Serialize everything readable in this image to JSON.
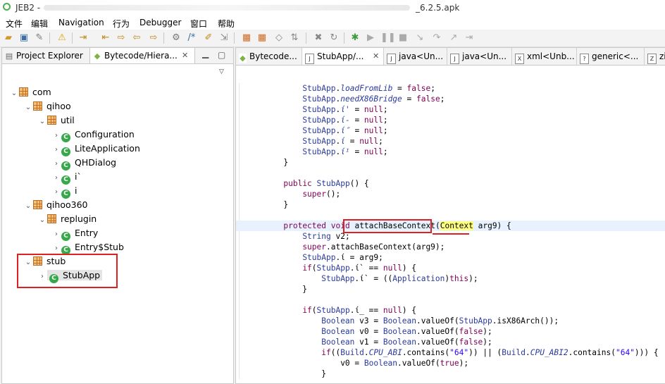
{
  "window": {
    "title_prefix": "JEB2 -",
    "title_suffix": "_6.2.5.apk"
  },
  "menu": [
    "文件",
    "编辑",
    "Navigation",
    "行为",
    "Debugger",
    "窗口",
    "帮助"
  ],
  "toolbar_icons": [
    "open-icon",
    "save-icon",
    "wrench-icon",
    "warning-icon",
    "import-icon",
    "export-icon",
    "back-icon",
    "forward-icon",
    "gear-icon",
    "comment-icon",
    "pencil-icon",
    "convert-icon",
    "grid-icon",
    "grid2-icon",
    "decompile-icon",
    "xref-icon",
    "delete-icon",
    "refresh-icon",
    "bug-icon",
    "resume-icon",
    "pause-icon",
    "stop-icon",
    "step-into-icon",
    "step-over-icon",
    "step-out-icon",
    "run-to-icon"
  ],
  "left_tabs": [
    {
      "label": "Project Explorer",
      "icon": "project-icon"
    },
    {
      "label": "Bytecode/Hiera...",
      "icon": "android-icon"
    }
  ],
  "tree": [
    {
      "label": "com",
      "kind": "package",
      "level": 0,
      "expanded": true
    },
    {
      "label": "qihoo",
      "kind": "package",
      "level": 1,
      "expanded": true
    },
    {
      "label": "util",
      "kind": "package",
      "level": 2,
      "expanded": true
    },
    {
      "label": "Configuration",
      "kind": "class",
      "level": 3
    },
    {
      "label": "LiteApplication",
      "kind": "class",
      "level": 3
    },
    {
      "label": "QHDialog",
      "kind": "class",
      "level": 3
    },
    {
      "label": "i`",
      "kind": "class",
      "level": 3
    },
    {
      "label": "i",
      "kind": "class",
      "level": 3
    },
    {
      "label": "qihoo360",
      "kind": "package",
      "level": 1,
      "expanded": true
    },
    {
      "label": "replugin",
      "kind": "package",
      "level": 2,
      "expanded": true
    },
    {
      "label": "Entry",
      "kind": "class",
      "level": 3
    },
    {
      "label": "Entry$Stub",
      "kind": "class",
      "level": 3
    },
    {
      "label": "stub",
      "kind": "package",
      "level": 1,
      "expanded": true
    },
    {
      "label": "StubApp",
      "kind": "class",
      "level": 2,
      "selected": true
    }
  ],
  "editor_tabs": [
    {
      "label": "Bytecode...",
      "icon": "A"
    },
    {
      "label": "StubApp/...",
      "icon": "J",
      "active": true
    },
    {
      "label": "java<Un...",
      "icon": "J"
    },
    {
      "label": "java<Un...",
      "icon": "J"
    },
    {
      "label": "xml<Unb...",
      "icon": "X"
    },
    {
      "label": "generic<...",
      "icon": "?"
    },
    {
      "label": "zi",
      "icon": "Z"
    }
  ],
  "code": [
    [
      [
        "        ",
        "pl"
      ],
      [
        "StubApp",
        "ty"
      ],
      [
        ".",
        "pl"
      ],
      [
        "loadFromLib",
        "fi"
      ],
      [
        " = ",
        "pl"
      ],
      [
        "false",
        "kw"
      ],
      [
        ";",
        "pl"
      ]
    ],
    [
      [
        "        ",
        "pl"
      ],
      [
        "StubApp",
        "ty"
      ],
      [
        ".",
        "pl"
      ],
      [
        "needX86Bridge",
        "fi"
      ],
      [
        " = ",
        "pl"
      ],
      [
        "false",
        "kw"
      ],
      [
        ";",
        "pl"
      ]
    ],
    [
      [
        "        ",
        "pl"
      ],
      [
        "StubApp",
        "ty"
      ],
      [
        ".",
        "pl"
      ],
      [
        "ί'",
        "fi"
      ],
      [
        " = ",
        "pl"
      ],
      [
        "null",
        "kw"
      ],
      [
        ";",
        "pl"
      ]
    ],
    [
      [
        "        ",
        "pl"
      ],
      [
        "StubApp",
        "ty"
      ],
      [
        ".",
        "pl"
      ],
      [
        "ί-",
        "fi"
      ],
      [
        " = ",
        "pl"
      ],
      [
        "null",
        "kw"
      ],
      [
        ";",
        "pl"
      ]
    ],
    [
      [
        "        ",
        "pl"
      ],
      [
        "StubApp",
        "ty"
      ],
      [
        ".",
        "pl"
      ],
      [
        "ί″",
        "fi"
      ],
      [
        " = ",
        "pl"
      ],
      [
        "null",
        "kw"
      ],
      [
        ";",
        "pl"
      ]
    ],
    [
      [
        "        ",
        "pl"
      ],
      [
        "StubApp",
        "ty"
      ],
      [
        ".",
        "pl"
      ],
      [
        "ί",
        "fi"
      ],
      [
        " = ",
        "pl"
      ],
      [
        "null",
        "kw"
      ],
      [
        ";",
        "pl"
      ]
    ],
    [
      [
        "        ",
        "pl"
      ],
      [
        "StubApp",
        "ty"
      ],
      [
        ".",
        "pl"
      ],
      [
        "ίᴵ",
        "fi"
      ],
      [
        " = ",
        "pl"
      ],
      [
        "null",
        "kw"
      ],
      [
        ";",
        "pl"
      ]
    ],
    [
      [
        "    }",
        "pl"
      ]
    ],
    [
      [
        "",
        "pl"
      ]
    ],
    [
      [
        "    ",
        "pl"
      ],
      [
        "public",
        "kw"
      ],
      [
        " ",
        "pl"
      ],
      [
        "StubApp",
        "ty"
      ],
      [
        "() {",
        "pl"
      ]
    ],
    [
      [
        "        ",
        "pl"
      ],
      [
        "super",
        "kw"
      ],
      [
        "();",
        "pl"
      ]
    ],
    [
      [
        "    }",
        "pl"
      ]
    ],
    [
      [
        "",
        "pl"
      ]
    ],
    [
      [
        "    ",
        "pl"
      ],
      [
        "protected",
        "kw"
      ],
      [
        " ",
        "pl"
      ],
      [
        "void",
        "kw"
      ],
      [
        " ",
        "pl"
      ],
      [
        "attachBaseContext",
        "pl"
      ],
      [
        "(",
        "pl"
      ],
      [
        "Context",
        "hl"
      ],
      [
        " arg9) {",
        "pl"
      ]
    ],
    [
      [
        "        ",
        "pl"
      ],
      [
        "String",
        "ty"
      ],
      [
        " v2;",
        "pl"
      ]
    ],
    [
      [
        "        ",
        "pl"
      ],
      [
        "super",
        "kw"
      ],
      [
        ".attachBaseContext(arg9);",
        "pl"
      ]
    ],
    [
      [
        "        ",
        "pl"
      ],
      [
        "StubApp",
        "ty"
      ],
      [
        ".ί = arg9;",
        "pl"
      ]
    ],
    [
      [
        "        ",
        "pl"
      ],
      [
        "if",
        "kw"
      ],
      [
        "(",
        "pl"
      ],
      [
        "StubApp",
        "ty"
      ],
      [
        ".ί` == ",
        "pl"
      ],
      [
        "null",
        "kw"
      ],
      [
        ") {",
        "pl"
      ]
    ],
    [
      [
        "            ",
        "pl"
      ],
      [
        "StubApp",
        "ty"
      ],
      [
        ".ί` = ((",
        "pl"
      ],
      [
        "Application",
        "ty"
      ],
      [
        ")",
        "pl"
      ],
      [
        "this",
        "kw"
      ],
      [
        ");",
        "pl"
      ]
    ],
    [
      [
        "        }",
        "pl"
      ]
    ],
    [
      [
        "",
        "pl"
      ]
    ],
    [
      [
        "        ",
        "pl"
      ],
      [
        "if",
        "kw"
      ],
      [
        "(",
        "pl"
      ],
      [
        "StubApp",
        "ty"
      ],
      [
        ".ί_ == ",
        "pl"
      ],
      [
        "null",
        "kw"
      ],
      [
        ") {",
        "pl"
      ]
    ],
    [
      [
        "            ",
        "pl"
      ],
      [
        "Boolean",
        "ty"
      ],
      [
        " v3 = ",
        "pl"
      ],
      [
        "Boolean",
        "ty"
      ],
      [
        ".valueOf(",
        "pl"
      ],
      [
        "StubApp",
        "ty"
      ],
      [
        ".isX86Arch());",
        "pl"
      ]
    ],
    [
      [
        "            ",
        "pl"
      ],
      [
        "Boolean",
        "ty"
      ],
      [
        " v0 = ",
        "pl"
      ],
      [
        "Boolean",
        "ty"
      ],
      [
        ".valueOf(",
        "pl"
      ],
      [
        "false",
        "kw"
      ],
      [
        ");",
        "pl"
      ]
    ],
    [
      [
        "            ",
        "pl"
      ],
      [
        "Boolean",
        "ty"
      ],
      [
        " v1 = ",
        "pl"
      ],
      [
        "Boolean",
        "ty"
      ],
      [
        ".valueOf(",
        "pl"
      ],
      [
        "false",
        "kw"
      ],
      [
        ");",
        "pl"
      ]
    ],
    [
      [
        "            ",
        "pl"
      ],
      [
        "if",
        "kw"
      ],
      [
        "((",
        "pl"
      ],
      [
        "Build",
        "ty"
      ],
      [
        ".",
        "pl"
      ],
      [
        "CPU_ABI",
        "fi"
      ],
      [
        ".contains(",
        "pl"
      ],
      [
        "\"64\"",
        "st"
      ],
      [
        ")) || (",
        "pl"
      ],
      [
        "Build",
        "ty"
      ],
      [
        ".",
        "pl"
      ],
      [
        "CPU_ABI2",
        "fi"
      ],
      [
        ".contains(",
        "pl"
      ],
      [
        "\"64\"",
        "st"
      ],
      [
        "))) {",
        "pl"
      ]
    ],
    [
      [
        "                v0 = ",
        "pl"
      ],
      [
        "Boolean",
        "ty"
      ],
      [
        ".valueOf(",
        "pl"
      ],
      [
        "true",
        "kw"
      ],
      [
        ");",
        "pl"
      ]
    ],
    [
      [
        "            }",
        "pl"
      ]
    ]
  ]
}
